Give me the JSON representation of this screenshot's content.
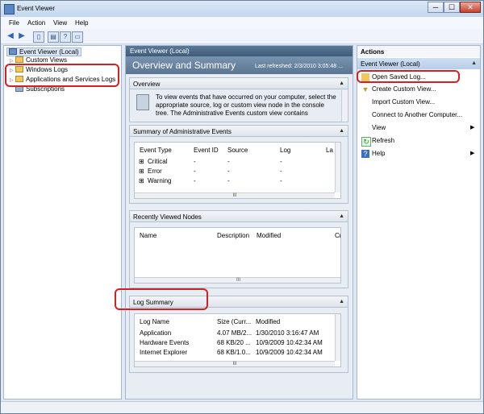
{
  "window": {
    "title": "Event Viewer",
    "minimize": "─",
    "maximize": "☐",
    "close": "✕"
  },
  "menu": [
    "File",
    "Action",
    "View",
    "Help"
  ],
  "tree": {
    "root": "Event Viewer (Local)",
    "items": [
      "Custom Views",
      "Windows Logs",
      "Applications and Services Logs",
      "Subscriptions"
    ]
  },
  "main": {
    "header": "Event Viewer (Local)",
    "title": "Overview and Summary",
    "refreshed": "Last refreshed: 2/3/2010 3:05:48 ...",
    "overview": {
      "label": "Overview",
      "text": "To view events that have occurred on your computer, select the appropriate source, log or custom view node in the console tree. The Administrative Events custom view contains"
    },
    "admin": {
      "label": "Summary of Administrative Events",
      "columns": [
        "Event Type",
        "Event ID",
        "Source",
        "Log",
        "La"
      ],
      "rows": [
        {
          "type": "Critical",
          "id": "-",
          "source": "-",
          "log": "-"
        },
        {
          "type": "Error",
          "id": "-",
          "source": "-",
          "log": "-"
        },
        {
          "type": "Warning",
          "id": "-",
          "source": "-",
          "log": "-"
        }
      ]
    },
    "recent": {
      "label": "Recently Viewed Nodes",
      "columns": [
        "Name",
        "Description",
        "Modified",
        "Cr"
      ]
    },
    "logsummary": {
      "label": "Log Summary",
      "columns": [
        "Log Name",
        "Size (Curr...",
        "Modified"
      ],
      "rows": [
        {
          "name": "Application",
          "size": "4.07 MB/2...",
          "modified": "1/30/2010 3:16:47 AM"
        },
        {
          "name": "Hardware Events",
          "size": "68 KB/20 ...",
          "modified": "10/9/2009 10:42:34 AM"
        },
        {
          "name": "Internet Explorer",
          "size": "68 KB/1.0...",
          "modified": "10/9/2009 10:42:34 AM"
        }
      ]
    },
    "scroll_thumb": "III"
  },
  "actions": {
    "title": "Actions",
    "group": "Event Viewer (Local)",
    "items": [
      "Open Saved Log...",
      "Create Custom View...",
      "Import Custom View...",
      "Connect to Another Computer...",
      "View",
      "Refresh",
      "Help"
    ]
  },
  "colors": {
    "highlight": "#d42020",
    "accent": "#3e5c7b"
  }
}
